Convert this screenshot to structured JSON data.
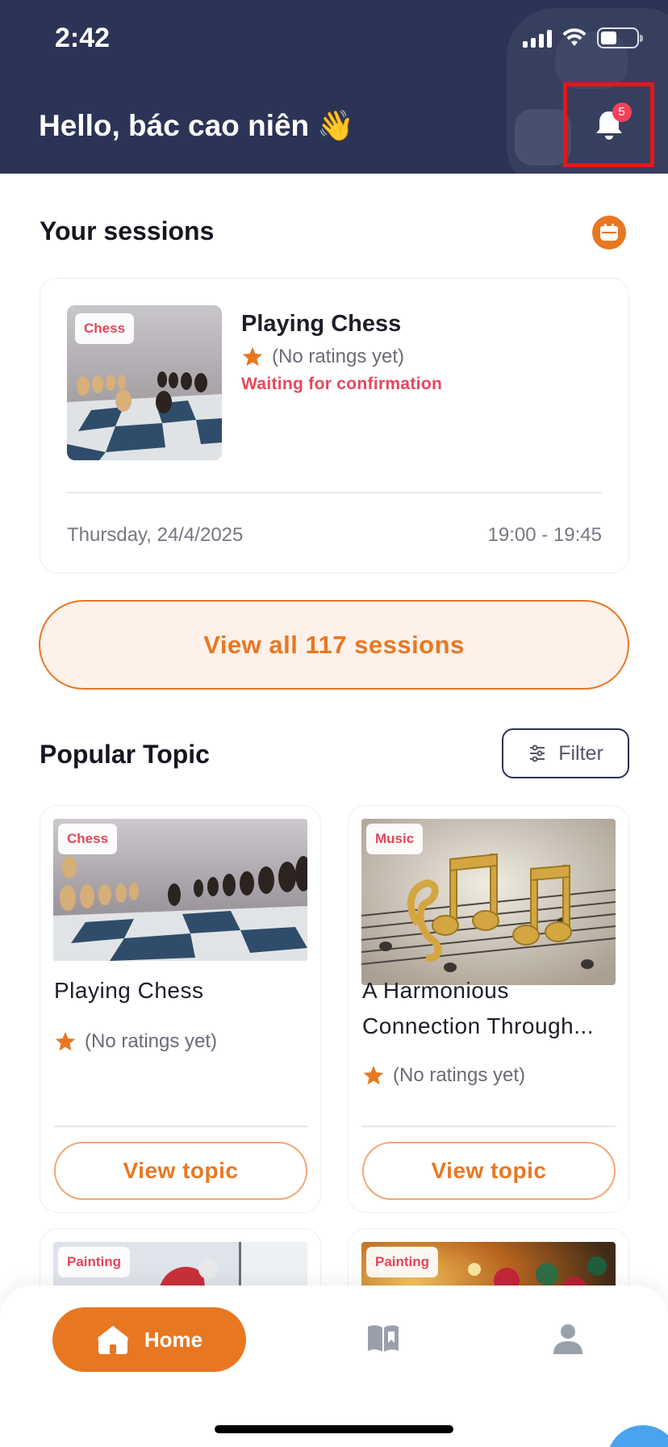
{
  "status_bar": {
    "time": "2:42"
  },
  "header": {
    "greeting": "Hello, bác cao niên 👋",
    "notification_count": "5"
  },
  "sessions": {
    "title": "Your sessions",
    "card": {
      "tag": "Chess",
      "name": "Playing Chess",
      "rating": "(No ratings yet)",
      "status": "Waiting for confirmation",
      "date": "Thursday, 24/4/2025",
      "time": "19:00 - 19:45"
    },
    "view_all_label": "View all 117 sessions"
  },
  "popular": {
    "title": "Popular Topic",
    "filter_label": "Filter",
    "topics": [
      {
        "tag": "Chess",
        "name_lines": [
          "Playing Chess"
        ],
        "rating": "(No ratings yet)",
        "button": "View topic"
      },
      {
        "tag": "Music",
        "name_lines": [
          "A Harmonious",
          "Connection Through..."
        ],
        "rating": "(No ratings yet)",
        "button": "View topic"
      },
      {
        "tag": "Painting"
      },
      {
        "tag": "Painting"
      }
    ]
  },
  "nav": {
    "home_label": "Home"
  },
  "colors": {
    "header_bg": "#2b3456",
    "accent": "#e87722",
    "status_red": "#e8465c"
  }
}
